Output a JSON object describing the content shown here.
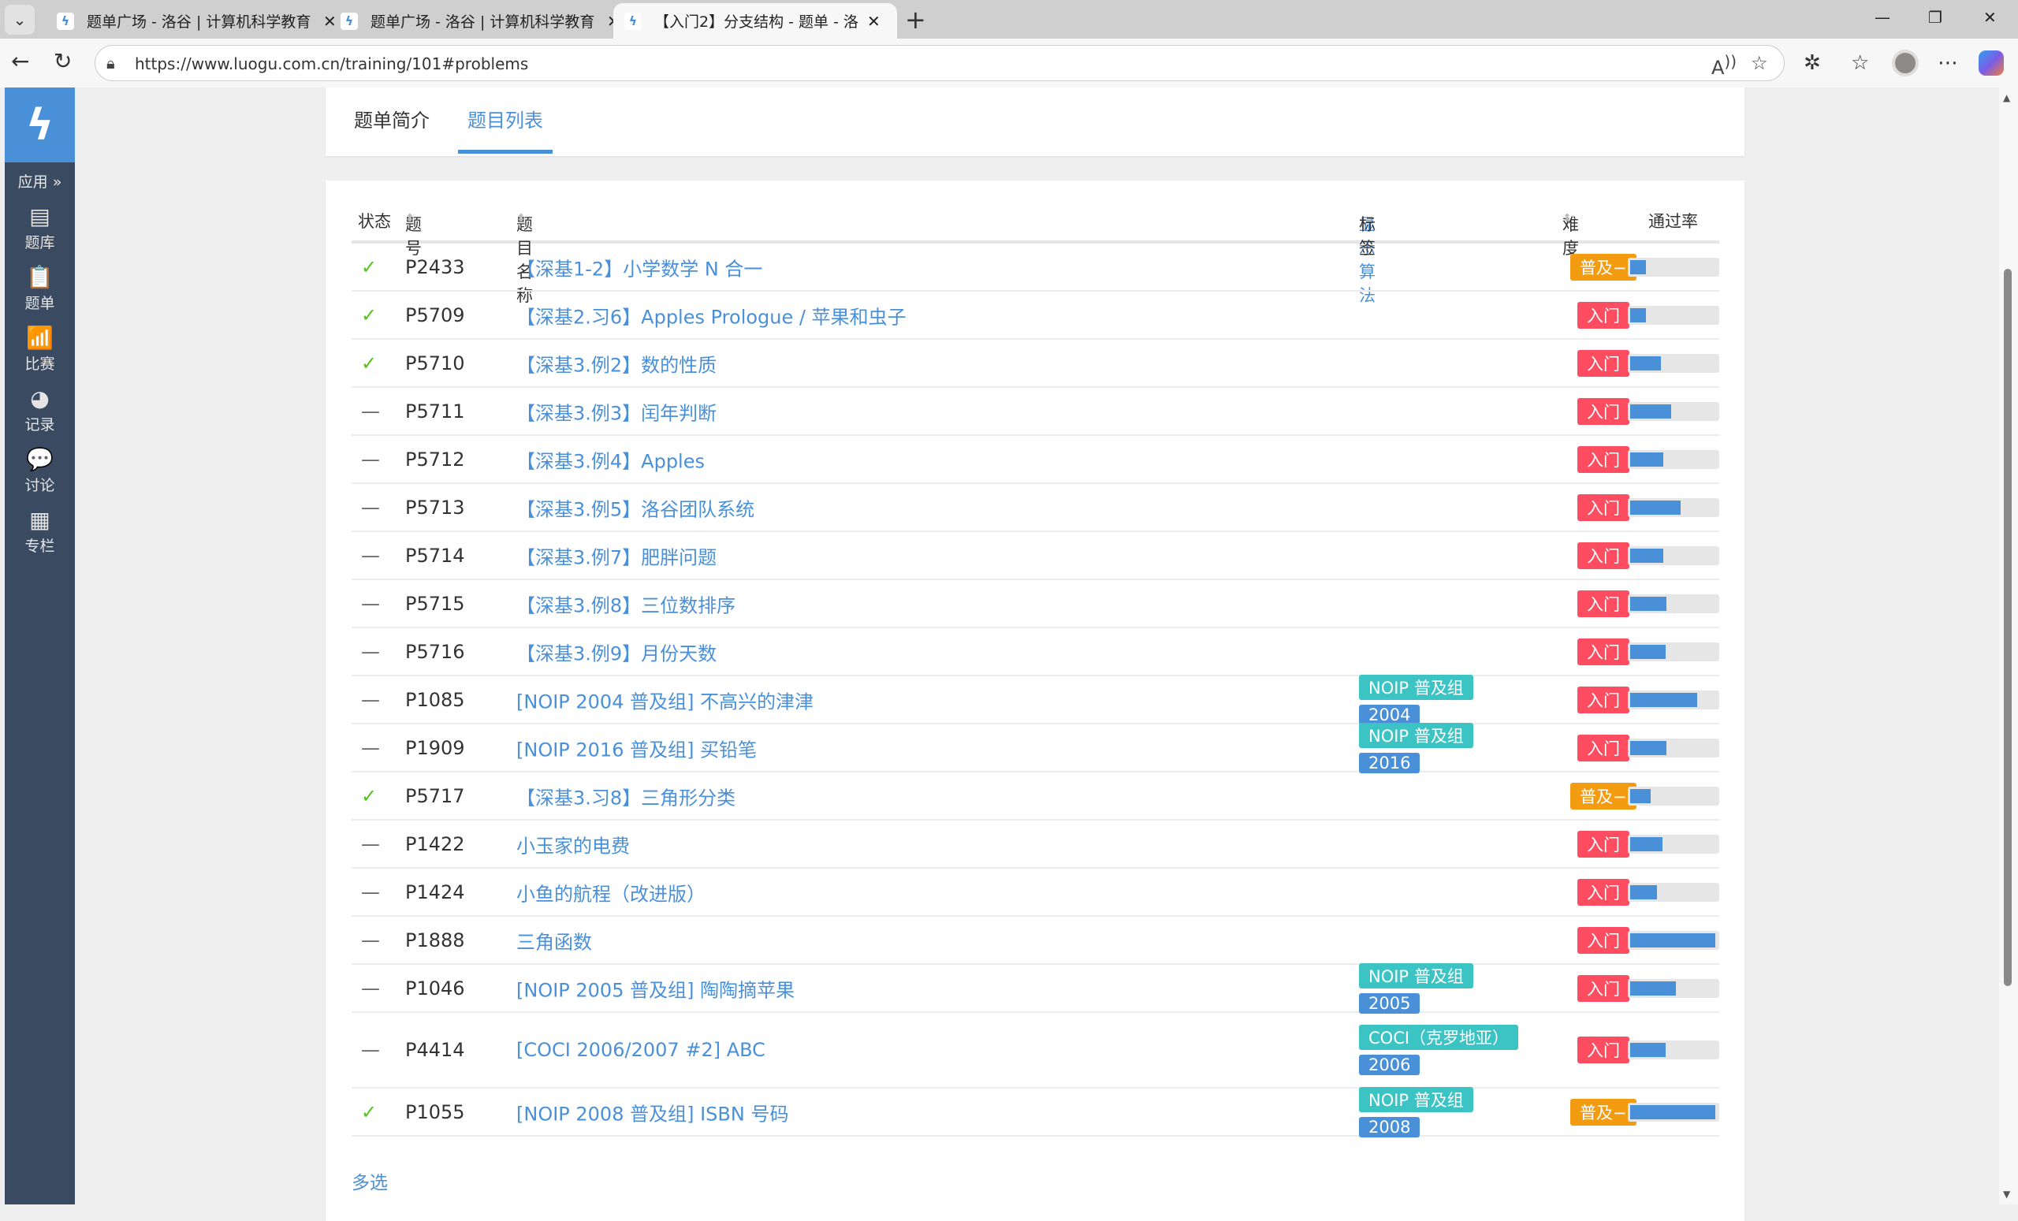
{
  "browser": {
    "tabs": [
      {
        "title": "题单广场 - 洛谷 | 计算机科学教育"
      },
      {
        "title": "题单广场 - 洛谷 | 计算机科学教育"
      },
      {
        "title": "【入门2】分支结构 - 题单 - 洛谷"
      }
    ],
    "url": "https://www.luogu.com.cn/training/101#problems"
  },
  "sidebar": {
    "apps": "应用 »",
    "items": [
      {
        "label": "题库",
        "icon": "book-icon",
        "glyph": "▤"
      },
      {
        "label": "题单",
        "icon": "clipboard-icon",
        "glyph": "📋"
      },
      {
        "label": "比赛",
        "icon": "signal-bars-icon",
        "glyph": "📶"
      },
      {
        "label": "记录",
        "icon": "pie-chart-icon",
        "glyph": "◕"
      },
      {
        "label": "讨论",
        "icon": "comments-icon",
        "glyph": "💬"
      },
      {
        "label": "专栏",
        "icon": "newspaper-icon",
        "glyph": "▦"
      }
    ]
  },
  "page": {
    "tabs": [
      {
        "label": "题单简介"
      },
      {
        "label": "题目列表"
      }
    ],
    "active_tab": 1
  },
  "table": {
    "headers": {
      "status": "状态",
      "pid": "题号",
      "title": "题目名称",
      "show_algo": "显示算法",
      "tags": "标签",
      "difficulty": "难度",
      "pass_rate": "通过率"
    },
    "colors": {
      "入门": "#fe4c61",
      "普及−": "#f39c11",
      "tag_source": "#3bc4c3",
      "tag_year": "#4a90d9"
    },
    "rows": [
      {
        "status": "accepted",
        "pid": "P2433",
        "title": "【深基1-2】小学数学 N 合一",
        "tags": [],
        "difficulty": "普及−",
        "pass_rate": 0.18
      },
      {
        "status": "accepted",
        "pid": "P5709",
        "title": "【深基2.习6】Apples Prologue / 苹果和虫子",
        "tags": [],
        "difficulty": "入门",
        "pass_rate": 0.18
      },
      {
        "status": "accepted",
        "pid": "P5710",
        "title": "【深基3.例2】数的性质",
        "tags": [],
        "difficulty": "入门",
        "pass_rate": 0.35
      },
      {
        "status": "none",
        "pid": "P5711",
        "title": "【深基3.例3】闰年判断",
        "tags": [],
        "difficulty": "入门",
        "pass_rate": 0.47
      },
      {
        "status": "none",
        "pid": "P5712",
        "title": "【深基3.例4】Apples",
        "tags": [],
        "difficulty": "入门",
        "pass_rate": 0.38
      },
      {
        "status": "none",
        "pid": "P5713",
        "title": "【深基3.例5】洛谷团队系统",
        "tags": [],
        "difficulty": "入门",
        "pass_rate": 0.58
      },
      {
        "status": "none",
        "pid": "P5714",
        "title": "【深基3.例7】肥胖问题",
        "tags": [],
        "difficulty": "入门",
        "pass_rate": 0.38
      },
      {
        "status": "none",
        "pid": "P5715",
        "title": "【深基3.例8】三位数排序",
        "tags": [],
        "difficulty": "入门",
        "pass_rate": 0.42
      },
      {
        "status": "none",
        "pid": "P5716",
        "title": "【深基3.例9】月份天数",
        "tags": [],
        "difficulty": "入门",
        "pass_rate": 0.41
      },
      {
        "status": "none",
        "pid": "P1085",
        "title": "[NOIP 2004 普及组] 不高兴的津津",
        "tags": [
          {
            "label": "NOIP 普及组",
            "kind": "source"
          },
          {
            "label": "2004",
            "kind": "year"
          }
        ],
        "difficulty": "入门",
        "pass_rate": 0.77
      },
      {
        "status": "none",
        "pid": "P1909",
        "title": "[NOIP 2016 普及组] 买铅笔",
        "tags": [
          {
            "label": "NOIP 普及组",
            "kind": "source"
          },
          {
            "label": "2016",
            "kind": "year"
          }
        ],
        "difficulty": "入门",
        "pass_rate": 0.42
      },
      {
        "status": "accepted",
        "pid": "P5717",
        "title": "【深基3.习8】三角形分类",
        "tags": [],
        "difficulty": "普及−",
        "pass_rate": 0.24
      },
      {
        "status": "none",
        "pid": "P1422",
        "title": "小玉家的电费",
        "tags": [],
        "difficulty": "入门",
        "pass_rate": 0.37
      },
      {
        "status": "none",
        "pid": "P1424",
        "title": "小鱼的航程（改进版）",
        "tags": [],
        "difficulty": "入门",
        "pass_rate": 0.31
      },
      {
        "status": "none",
        "pid": "P1888",
        "title": "三角函数",
        "tags": [],
        "difficulty": "入门",
        "pass_rate": 0.98
      },
      {
        "status": "none",
        "pid": "P1046",
        "title": "[NOIP 2005 普及组] 陶陶摘苹果",
        "tags": [
          {
            "label": "NOIP 普及组",
            "kind": "source"
          },
          {
            "label": "2005",
            "kind": "year"
          }
        ],
        "difficulty": "入门",
        "pass_rate": 0.53
      },
      {
        "status": "none",
        "pid": "P4414",
        "title": "[COCI 2006/2007 #2] ABC",
        "tags": [
          {
            "label": "COCI（克罗地亚）",
            "kind": "source"
          },
          {
            "label": "2006",
            "kind": "year"
          }
        ],
        "difficulty": "入门",
        "pass_rate": 0.41
      },
      {
        "status": "accepted",
        "pid": "P1055",
        "title": "[NOIP 2008 普及组] ISBN 号码",
        "tags": [
          {
            "label": "NOIP 普及组",
            "kind": "source"
          },
          {
            "label": "2008",
            "kind": "year"
          }
        ],
        "difficulty": "普及−",
        "pass_rate": 0.98
      }
    ],
    "multi_select": "多选"
  }
}
